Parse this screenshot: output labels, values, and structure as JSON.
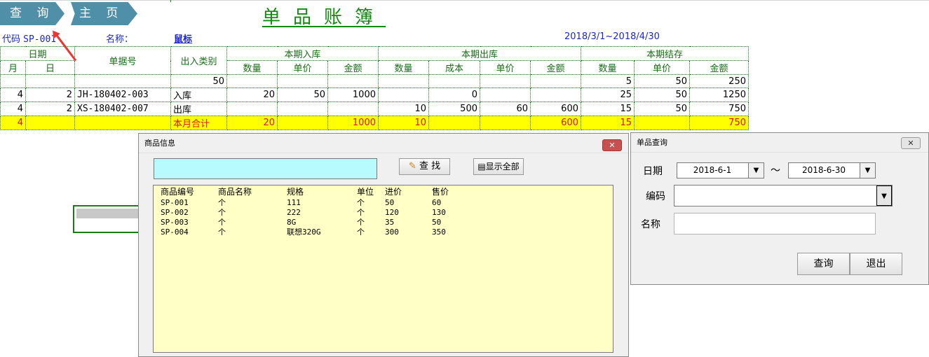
{
  "nav": {
    "query_label": "查 询",
    "home_label": "主 页"
  },
  "title": "单品账簿",
  "header": {
    "code_label": "代码",
    "code_value": "SP-001",
    "name_label": "名称：",
    "name_value": "鼠标",
    "date_range": "2018/3/1~2018/4/30"
  },
  "ledger": {
    "headers": {
      "date": "日期",
      "month": "月",
      "day": "日",
      "doc_no": "单据号",
      "type": "出入类别",
      "in": "本期入库",
      "out": "本期出库",
      "bal": "本期结存",
      "qty": "数量",
      "price": "单价",
      "amount": "金额",
      "cost": "成本"
    },
    "opening": {
      "type": "50",
      "bal_qty": "5",
      "bal_price": "50",
      "bal_amount": "250"
    },
    "rows": [
      {
        "m": "4",
        "d": "2",
        "doc": "JH-180402-003",
        "type": "入库",
        "in_qty": "20",
        "in_price": "50",
        "in_amount": "1000",
        "out_qty": "",
        "out_cost": "0",
        "out_price": "",
        "out_amount": "",
        "bal_qty": "25",
        "bal_price": "50",
        "bal_amount": "1250"
      },
      {
        "m": "4",
        "d": "2",
        "doc": "XS-180402-007",
        "type": "出库",
        "in_qty": "",
        "in_price": "",
        "in_amount": "",
        "out_qty": "10",
        "out_cost": "500",
        "out_price": "60",
        "out_amount": "600",
        "bal_qty": "15",
        "bal_price": "50",
        "bal_amount": "750"
      }
    ],
    "total": {
      "m": "4",
      "type": "本月合计",
      "in_qty": "20",
      "in_amount": "1000",
      "out_qty": "10",
      "out_amount": "600",
      "bal_qty": "15",
      "bal_amount": "750"
    }
  },
  "product_dialog": {
    "title": "商品信息",
    "close": "✕",
    "search_value": "",
    "find_label": "查 找",
    "show_all_label": "显示全部",
    "columns": [
      "商品编号",
      "商品名称",
      "规格",
      "单位",
      "进价",
      "售价"
    ],
    "items": [
      [
        "SP-001",
        "个",
        "111",
        "个",
        "50",
        "60"
      ],
      [
        "SP-002",
        "个",
        "222",
        "个",
        "120",
        "130"
      ],
      [
        "SP-003",
        "个",
        "8G",
        "个",
        "35",
        "50"
      ],
      [
        "SP-004",
        "个",
        "联想320G",
        "个",
        "300",
        "350"
      ]
    ]
  },
  "query_dialog": {
    "title": "单品查询",
    "close": "✕",
    "date_label": "日期",
    "date_from": "2018-6-1",
    "tilde": "～",
    "date_to": "2018-6-30",
    "code_label": "编码",
    "code_value": "",
    "name_label": "名称",
    "name_value": "",
    "query_btn": "查询",
    "exit_btn": "退出"
  },
  "icons": {
    "dropdown": "▼"
  },
  "colors": {
    "nav": "#4f8fa8",
    "title": "#118a11",
    "highlight": "#ffff00",
    "list_bg": "#ffffc6",
    "search_bg": "#b8fbff",
    "annotation": "#ee3333"
  }
}
